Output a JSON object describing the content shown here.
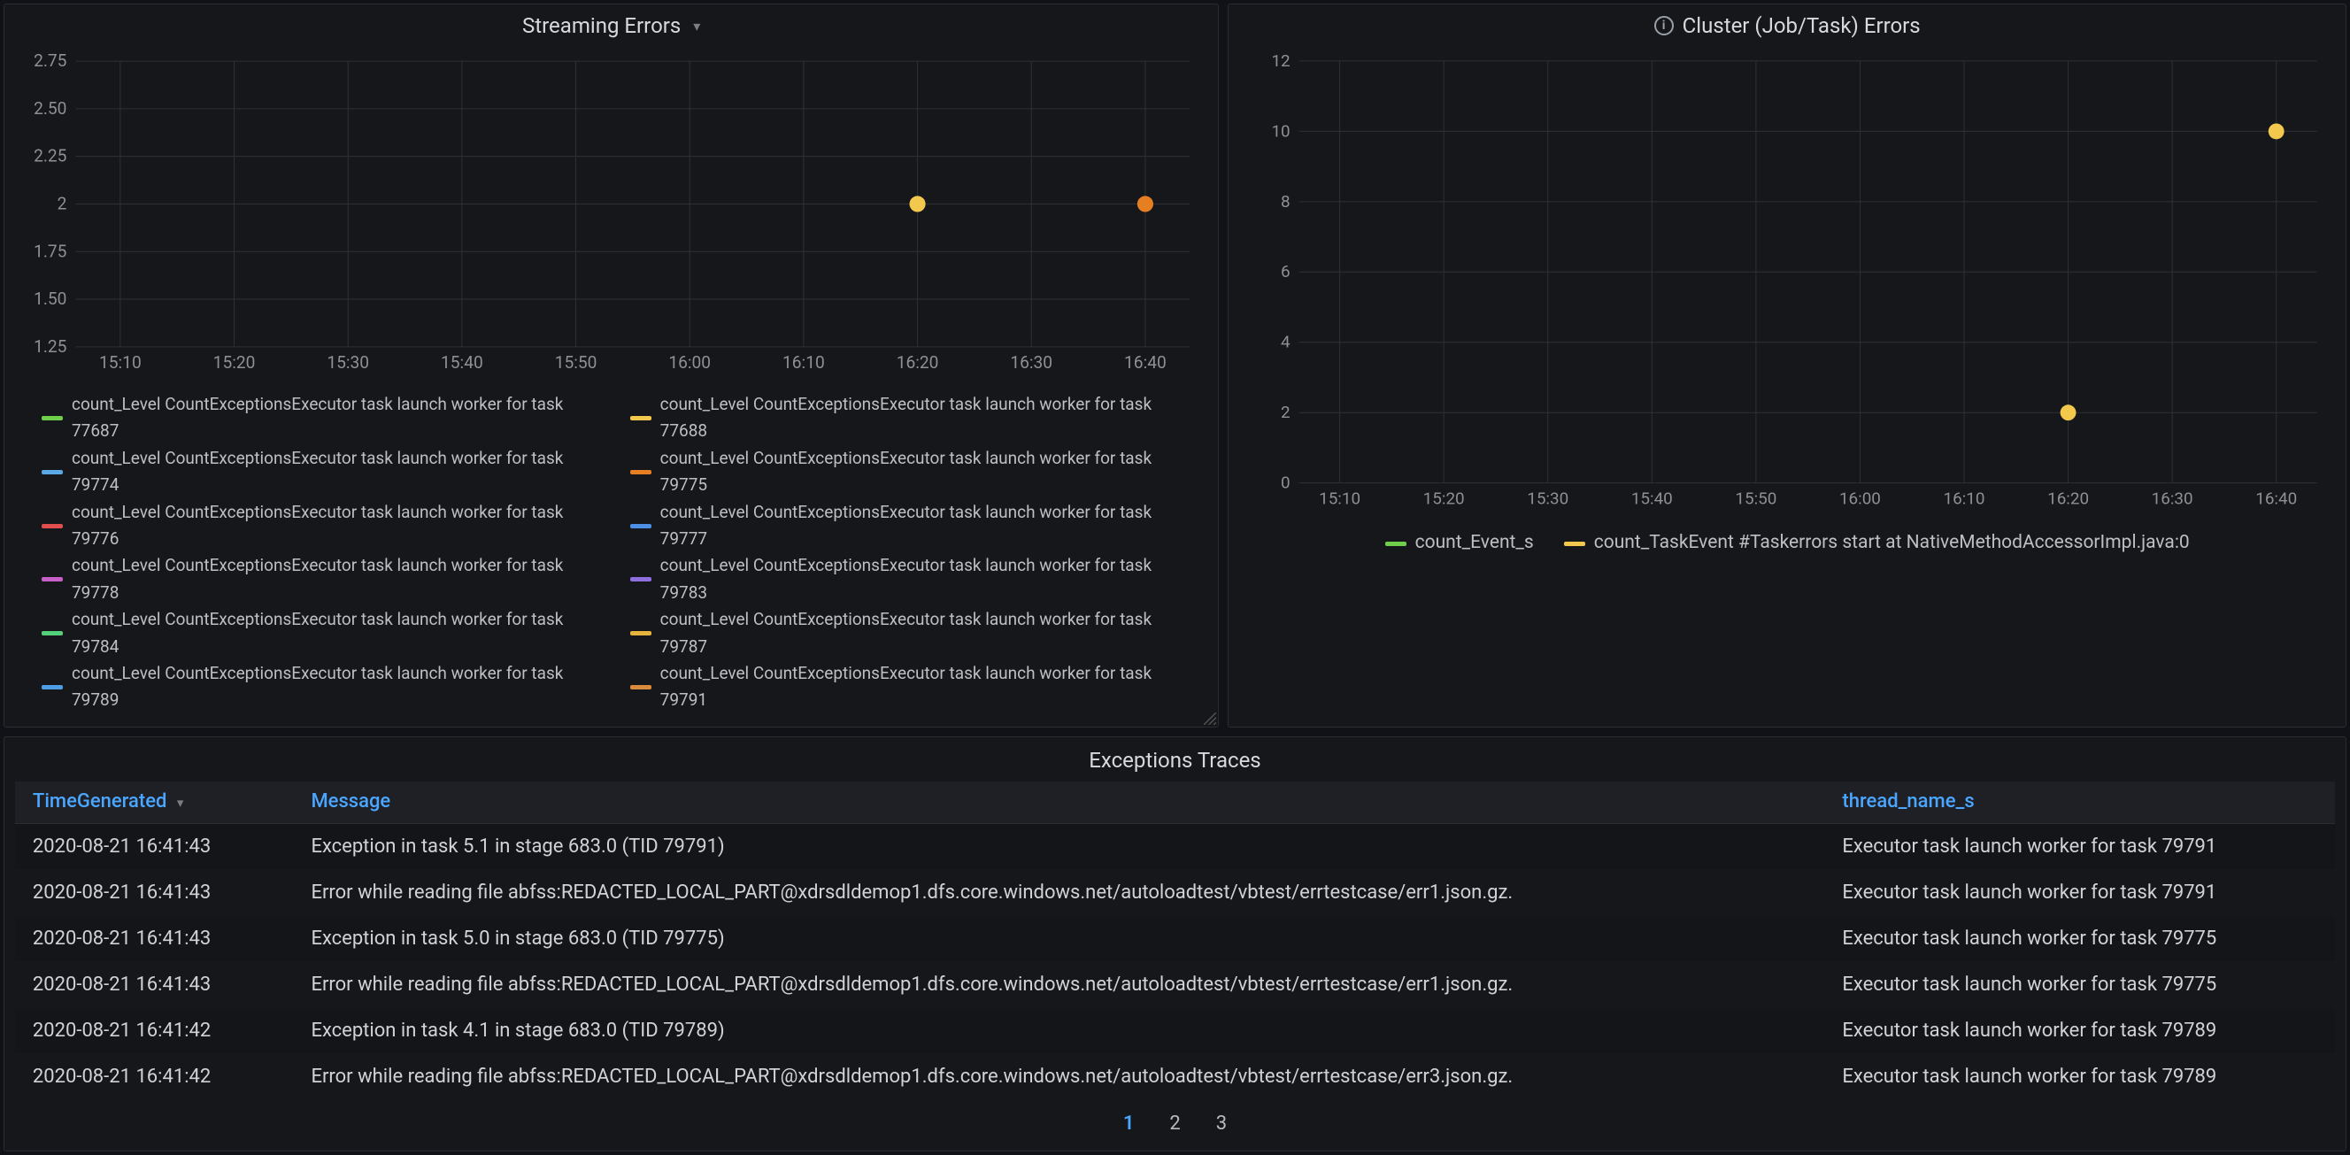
{
  "panels": {
    "streaming": {
      "title": "Streaming Errors"
    },
    "cluster": {
      "title": "Cluster (Job/Task) Errors"
    }
  },
  "chart_data": [
    {
      "id": "streaming",
      "type": "scatter",
      "title": "Streaming Errors",
      "xlabel": "",
      "ylabel": "",
      "ylim": [
        1.25,
        2.75
      ],
      "yticks": [
        1.25,
        1.5,
        1.75,
        2.0,
        2.25,
        2.5,
        2.75
      ],
      "xticks": [
        "15:10",
        "15:20",
        "15:30",
        "15:40",
        "15:50",
        "16:00",
        "16:10",
        "16:20",
        "16:30",
        "16:40"
      ],
      "series": [
        {
          "name": "count_Level CountExceptionsExecutor task launch worker for task 77687",
          "color": "#6fcf4b",
          "x": [],
          "y": []
        },
        {
          "name": "count_Level CountExceptionsExecutor task launch worker for task 77688",
          "color": "#f2c94c",
          "x": [
            "16:20"
          ],
          "y": [
            2.0
          ]
        },
        {
          "name": "count_Level CountExceptionsExecutor task launch worker for task 79774",
          "color": "#5aa9e6",
          "x": [],
          "y": []
        },
        {
          "name": "count_Level CountExceptionsExecutor task launch worker for task 79775",
          "color": "#e67e22",
          "x": [
            "16:40"
          ],
          "y": [
            2.0
          ]
        },
        {
          "name": "count_Level CountExceptionsExecutor task launch worker for task 79776",
          "color": "#e24d4d",
          "x": [],
          "y": []
        },
        {
          "name": "count_Level CountExceptionsExecutor task launch worker for task 79777",
          "color": "#4e8fe6",
          "x": [],
          "y": []
        },
        {
          "name": "count_Level CountExceptionsExecutor task launch worker for task 79778",
          "color": "#c85fc8",
          "x": [],
          "y": []
        },
        {
          "name": "count_Level CountExceptionsExecutor task launch worker for task 79783",
          "color": "#8f6fe0",
          "x": [],
          "y": []
        },
        {
          "name": "count_Level CountExceptionsExecutor task launch worker for task 79784",
          "color": "#53d17a",
          "x": [],
          "y": []
        },
        {
          "name": "count_Level CountExceptionsExecutor task launch worker for task 79787",
          "color": "#e6b43c",
          "x": [],
          "y": []
        },
        {
          "name": "count_Level CountExceptionsExecutor task launch worker for task 79789",
          "color": "#4e9ee6",
          "x": [],
          "y": []
        },
        {
          "name": "count_Level CountExceptionsExecutor task launch worker for task 79791",
          "color": "#d98a3b",
          "x": [],
          "y": []
        }
      ]
    },
    {
      "id": "cluster",
      "type": "scatter",
      "title": "Cluster (Job/Task) Errors",
      "xlabel": "",
      "ylabel": "",
      "ylim": [
        0,
        12
      ],
      "yticks": [
        0,
        2,
        4,
        6,
        8,
        10,
        12
      ],
      "xticks": [
        "15:10",
        "15:20",
        "15:30",
        "15:40",
        "15:50",
        "16:00",
        "16:10",
        "16:20",
        "16:30",
        "16:40"
      ],
      "series": [
        {
          "name": "count_Event_s",
          "color": "#6fcf4b",
          "x": [],
          "y": []
        },
        {
          "name": "count_TaskEvent #Taskerrors start at NativeMethodAccessorImpl.java:0",
          "color": "#f2c94c",
          "x": [
            "16:20",
            "16:40"
          ],
          "y": [
            2,
            10
          ]
        }
      ]
    }
  ],
  "table": {
    "title": "Exceptions Traces",
    "columns": {
      "time": "TimeGenerated",
      "msg": "Message",
      "thread": "thread_name_s"
    },
    "rows": [
      {
        "t": "2020-08-21 16:41:43",
        "m": "Exception in task 5.1 in stage 683.0 (TID 79791)",
        "th": "Executor task launch worker for task 79791"
      },
      {
        "t": "2020-08-21 16:41:43",
        "m": "Error while reading file abfss:REDACTED_LOCAL_PART@xdrsdldemop1.dfs.core.windows.net/autoloadtest/vbtest/errtestcase/err1.json.gz.",
        "th": "Executor task launch worker for task 79791"
      },
      {
        "t": "2020-08-21 16:41:43",
        "m": "Exception in task 5.0 in stage 683.0 (TID 79775)",
        "th": "Executor task launch worker for task 79775"
      },
      {
        "t": "2020-08-21 16:41:43",
        "m": "Error while reading file abfss:REDACTED_LOCAL_PART@xdrsdldemop1.dfs.core.windows.net/autoloadtest/vbtest/errtestcase/err1.json.gz.",
        "th": "Executor task launch worker for task 79775"
      },
      {
        "t": "2020-08-21 16:41:42",
        "m": "Exception in task 4.1 in stage 683.0 (TID 79789)",
        "th": "Executor task launch worker for task 79789"
      },
      {
        "t": "2020-08-21 16:41:42",
        "m": "Error while reading file abfss:REDACTED_LOCAL_PART@xdrsdldemop1.dfs.core.windows.net/autoloadtest/vbtest/errtestcase/err3.json.gz.",
        "th": "Executor task launch worker for task 79789"
      }
    ],
    "pages": [
      "1",
      "2",
      "3"
    ],
    "activePage": 0
  }
}
